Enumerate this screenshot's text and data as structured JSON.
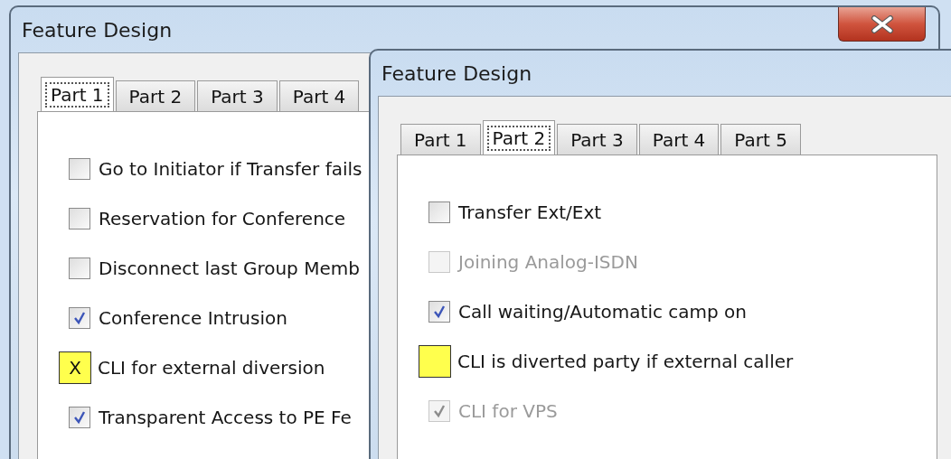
{
  "windows": [
    {
      "title": "Feature Design",
      "close_button": true,
      "tabs": [
        {
          "label": "Part 1",
          "selected": true
        },
        {
          "label": "Part 2",
          "selected": false
        },
        {
          "label": "Part 3",
          "selected": false
        },
        {
          "label": "Part 4",
          "selected": false
        }
      ],
      "options": [
        {
          "kind": "checkbox",
          "label": "Go to Initiator if Transfer fails",
          "checked": false,
          "disabled": false
        },
        {
          "kind": "checkbox",
          "label": "Reservation for Conference",
          "checked": false,
          "disabled": false
        },
        {
          "kind": "checkbox",
          "label": "Disconnect last Group Memb",
          "checked": false,
          "disabled": false
        },
        {
          "kind": "checkbox",
          "label": "Conference Intrusion",
          "checked": true,
          "disabled": false
        },
        {
          "kind": "marker",
          "mark": "X",
          "label": "CLI for external diversion"
        },
        {
          "kind": "checkbox",
          "label": "Transparent Access to PE Fe",
          "checked": true,
          "disabled": false
        }
      ]
    },
    {
      "title": "Feature Design",
      "tabs": [
        {
          "label": "Part 1",
          "selected": false
        },
        {
          "label": "Part 2",
          "selected": true
        },
        {
          "label": "Part 3",
          "selected": false
        },
        {
          "label": "Part 4",
          "selected": false
        },
        {
          "label": "Part 5",
          "selected": false
        }
      ],
      "options": [
        {
          "kind": "checkbox",
          "label": "Transfer Ext/Ext",
          "checked": false,
          "disabled": false
        },
        {
          "kind": "checkbox",
          "label": "Joining Analog-ISDN",
          "checked": false,
          "disabled": true
        },
        {
          "kind": "checkbox",
          "label": "Call waiting/Automatic camp on",
          "checked": true,
          "disabled": false
        },
        {
          "kind": "marker",
          "label": "CLI is diverted party if external caller"
        },
        {
          "kind": "checkbox",
          "label": "CLI for VPS",
          "checked": true,
          "disabled": true
        }
      ]
    }
  ]
}
